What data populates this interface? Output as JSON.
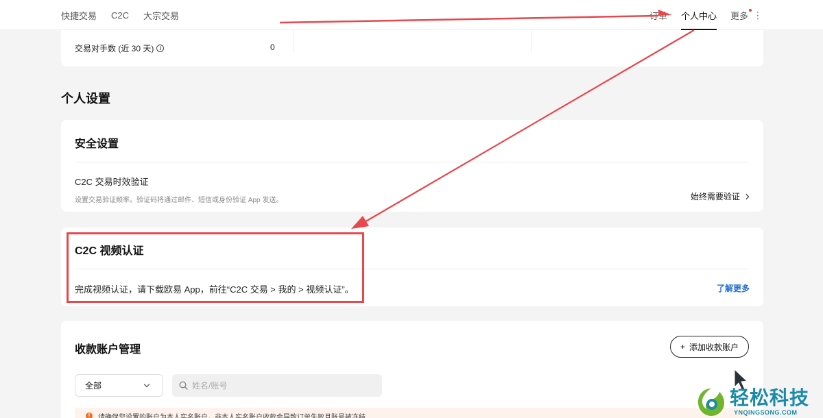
{
  "nav": {
    "left_links": [
      "快捷交易",
      "C2C",
      "大宗交易"
    ],
    "right_items": [
      "订单",
      "个人中心",
      "更多"
    ],
    "active": "个人中心"
  },
  "stats": {
    "counterparty_label": "交易对手数 (近 30 天)",
    "counterparty_value": "0"
  },
  "personal_settings": {
    "title": "个人设置"
  },
  "security": {
    "title": "安全设置",
    "row_title": "C2C 交易时效验证",
    "row_desc": "设置交易验证频率。验证码将通过邮件、短信或身份验证 App 发送。",
    "action": "始终需要验证"
  },
  "video_auth": {
    "title": "C2C 视频认证",
    "desc": "完成视频认证，请下载欧易 App，前往“C2C 交易 > 我的 > 视频认证”。",
    "link": "了解更多"
  },
  "payment_accounts": {
    "title": "收款账户管理",
    "add_button": "添加收款账户",
    "filter_value": "全部",
    "search_placeholder": "姓名/账号",
    "notice": "请确保您设置的账户为本人实名账户，非本人实名账户收款会导致订单失败且账号被冻结"
  },
  "watermark": {
    "text": "轻松科技",
    "sub": "YNQINGSONG.COM"
  },
  "colors": {
    "annotation_red": "#e8474c",
    "link_blue": "#1f6fd6",
    "watermark_teal": "#1b8aa8"
  }
}
